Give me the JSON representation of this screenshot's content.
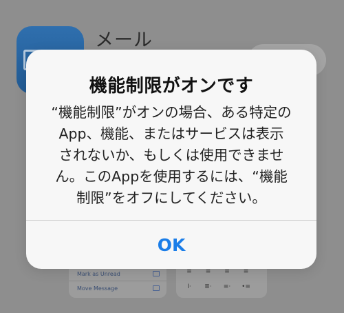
{
  "background": {
    "app_icon": "mail-app-icon",
    "app_name": "メール",
    "actions": [
      {
        "label": "Mark as Unread",
        "icon": "envelope-icon"
      },
      {
        "label": "Move Message",
        "icon": "folder-icon"
      }
    ],
    "format_marks": [
      "≡",
      "≡",
      "≡",
      "≡",
      "I·",
      "≣·",
      "≡·",
      "•≡"
    ]
  },
  "alert": {
    "title": "機能制限がオンです",
    "message_lines": [
      "“機能制限”がオンの場合、ある特定の",
      "App、機能、またはサービスは表示",
      "されないか、もしくは使用できませ",
      "ん。このAppを使用するには、“機能",
      "制限”をオフにしてください。"
    ],
    "button_label": "OK",
    "button_color": "#1a7de8"
  }
}
